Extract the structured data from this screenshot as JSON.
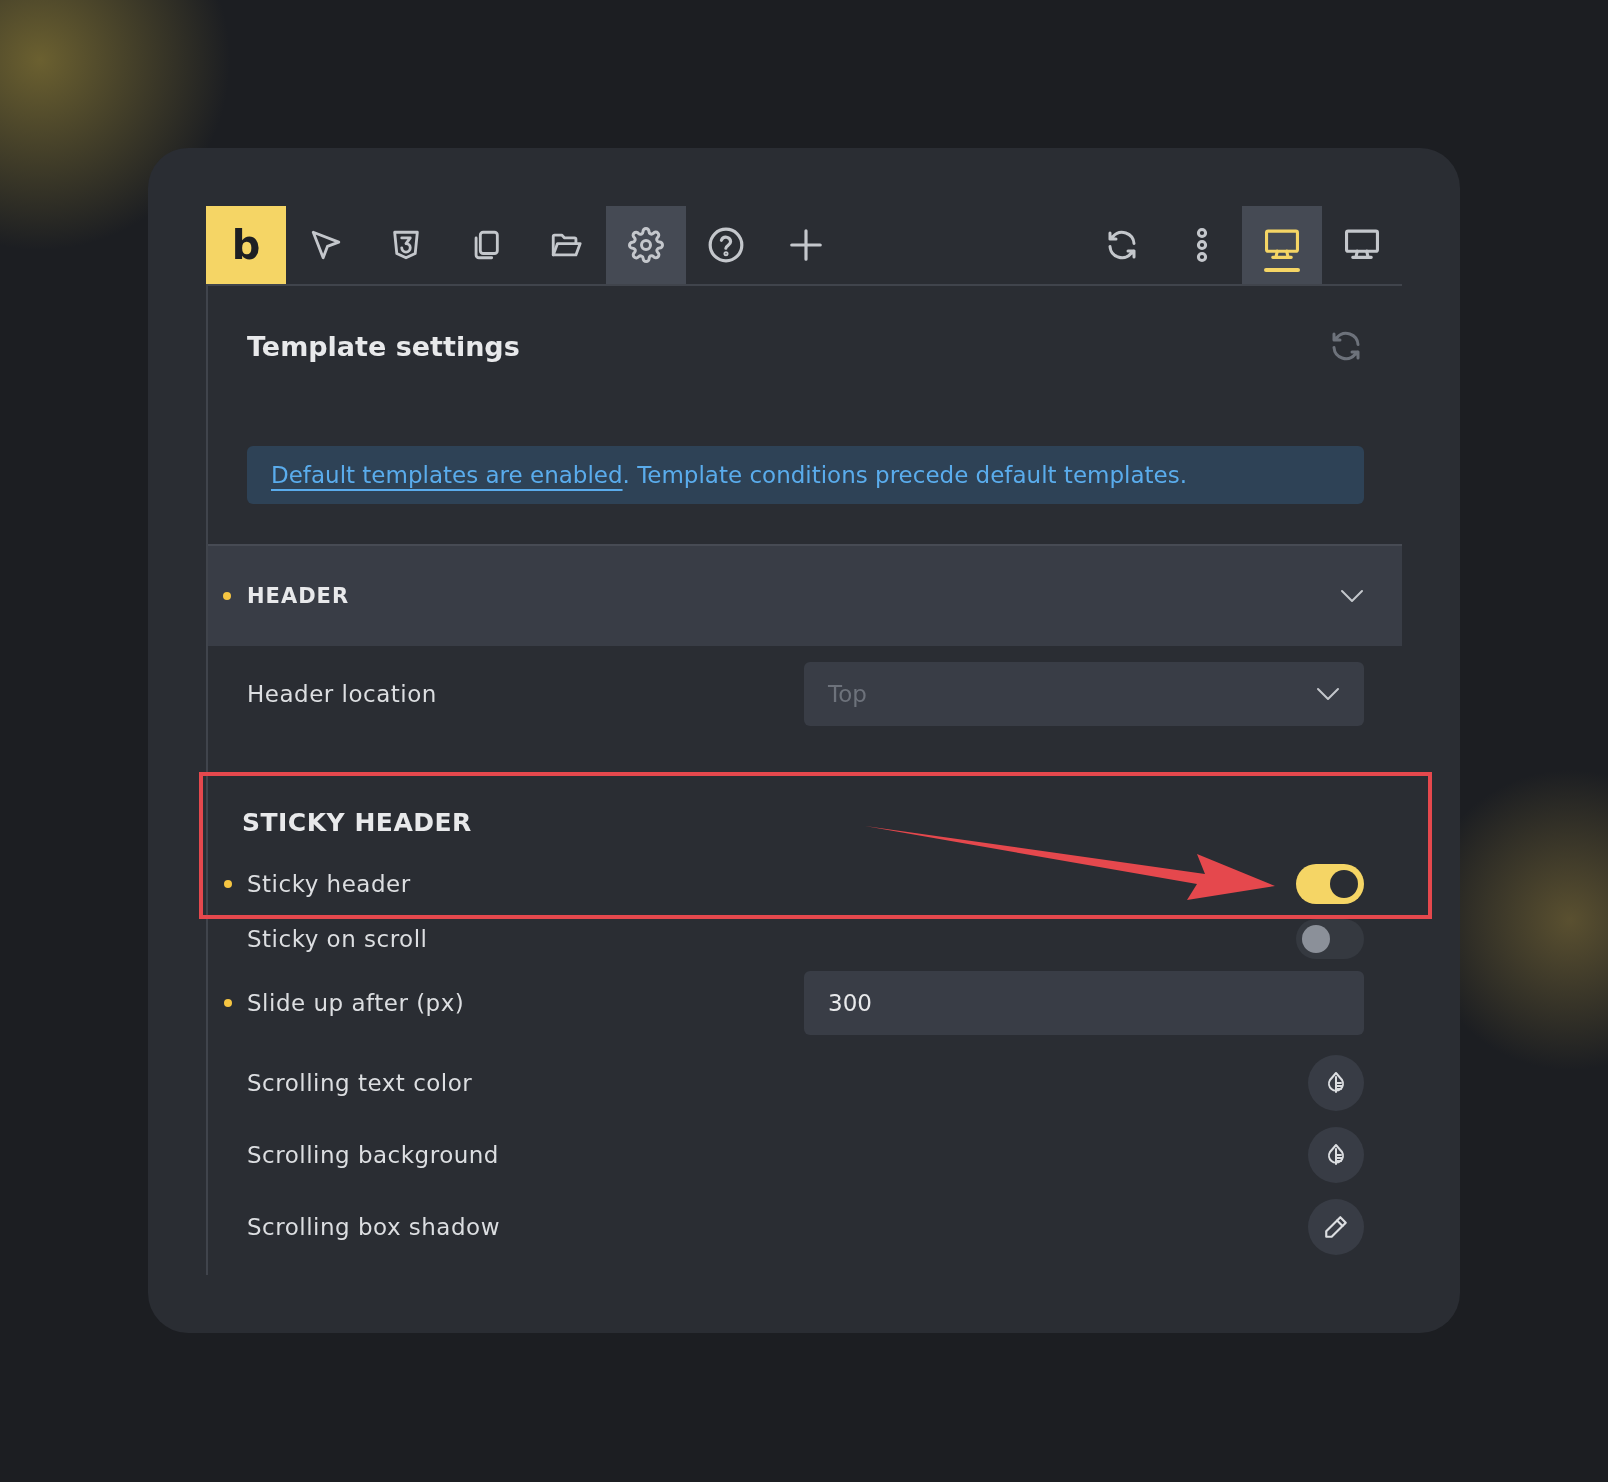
{
  "toolbar": {
    "logo": "b",
    "tools": [
      {
        "kind": "pointer",
        "selected": false
      },
      {
        "kind": "css",
        "selected": false
      },
      {
        "kind": "pages",
        "selected": false
      },
      {
        "kind": "folder",
        "selected": false
      },
      {
        "kind": "settings",
        "selected": true
      },
      {
        "kind": "help",
        "selected": false
      },
      {
        "kind": "add",
        "selected": false
      }
    ],
    "right_tools": [
      {
        "kind": "refresh",
        "selected": false
      },
      {
        "kind": "more",
        "selected": false
      },
      {
        "kind": "desktop",
        "selected": true
      },
      {
        "kind": "desktop",
        "selected": false
      }
    ]
  },
  "panel": {
    "title": "Template settings",
    "notice": {
      "link": "Default templates are enabled",
      "text": ". Template conditions precede default templates."
    },
    "section": {
      "title": "HEADER",
      "modified": true,
      "expanded": true
    },
    "rows": [
      {
        "kind": "select",
        "label": "Header location",
        "modified": false,
        "placeholder": "Top"
      }
    ],
    "sticky": {
      "title": "STICKY HEADER",
      "highlighted": true,
      "rows": [
        {
          "kind": "toggle",
          "label": "Sticky header",
          "modified": true,
          "on": true,
          "highlighted": true
        },
        {
          "kind": "toggle",
          "label": "Sticky on scroll",
          "modified": false,
          "on": false,
          "highlighted": false
        },
        {
          "kind": "number",
          "label": "Slide up after (px)",
          "modified": true,
          "value": "300",
          "highlighted": false
        },
        {
          "kind": "color",
          "label": "Scrolling text color",
          "modified": false,
          "highlighted": false
        },
        {
          "kind": "color",
          "label": "Scrolling background",
          "modified": false,
          "highlighted": false
        },
        {
          "kind": "shadow",
          "label": "Scrolling box shadow",
          "modified": false,
          "highlighted": false
        }
      ]
    }
  }
}
